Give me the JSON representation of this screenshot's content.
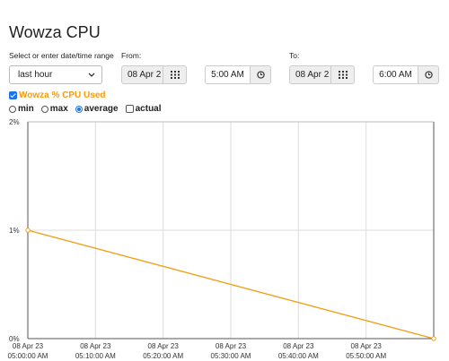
{
  "page_title": "Wowza CPU",
  "range": {
    "label": "Select or enter date/time range",
    "selected": "last hour"
  },
  "from": {
    "label": "From:",
    "date": "08 Apr 2",
    "time": "5:00 AM"
  },
  "to": {
    "label": "To:",
    "date": "08 Apr 2",
    "time": "6:00 AM"
  },
  "series_toggle": {
    "label": "Wowza % CPU Used",
    "checked": true,
    "color": "#f39c12"
  },
  "aggregation": {
    "options": [
      {
        "label": "min",
        "type": "radio",
        "checked": false
      },
      {
        "label": "max",
        "type": "radio",
        "checked": false
      },
      {
        "label": "average",
        "type": "radio",
        "checked": true
      },
      {
        "label": "actual",
        "type": "checkbox",
        "checked": false
      }
    ]
  },
  "icons": {
    "calendar": "calendar-icon",
    "clock": "clock-icon",
    "dropdown": "chevron-down-icon"
  },
  "chart_data": {
    "type": "line",
    "title": "",
    "xlabel": "",
    "ylabel": "",
    "ylim": [
      0,
      2
    ],
    "y_ticks": [
      {
        "value": 0,
        "label": "0%"
      },
      {
        "value": 1,
        "label": "1%"
      },
      {
        "value": 2,
        "label": "2%"
      }
    ],
    "x_range": [
      0,
      60
    ],
    "x_ticks": [
      {
        "value": 0,
        "date": "08 Apr 23",
        "time": "05:00:00 AM"
      },
      {
        "value": 10,
        "date": "08 Apr 23",
        "time": "05:10:00 AM"
      },
      {
        "value": 20,
        "date": "08 Apr 23",
        "time": "05:20:00 AM"
      },
      {
        "value": 30,
        "date": "08 Apr 23",
        "time": "05:30:00 AM"
      },
      {
        "value": 40,
        "date": "08 Apr 23",
        "time": "05:40:00 AM"
      },
      {
        "value": 50,
        "date": "08 Apr 23",
        "time": "05:50:00 AM"
      }
    ],
    "grid": true,
    "series": [
      {
        "color": "#f39c12",
        "points": [
          [
            0,
            1
          ],
          [
            60,
            0
          ]
        ]
      }
    ]
  }
}
